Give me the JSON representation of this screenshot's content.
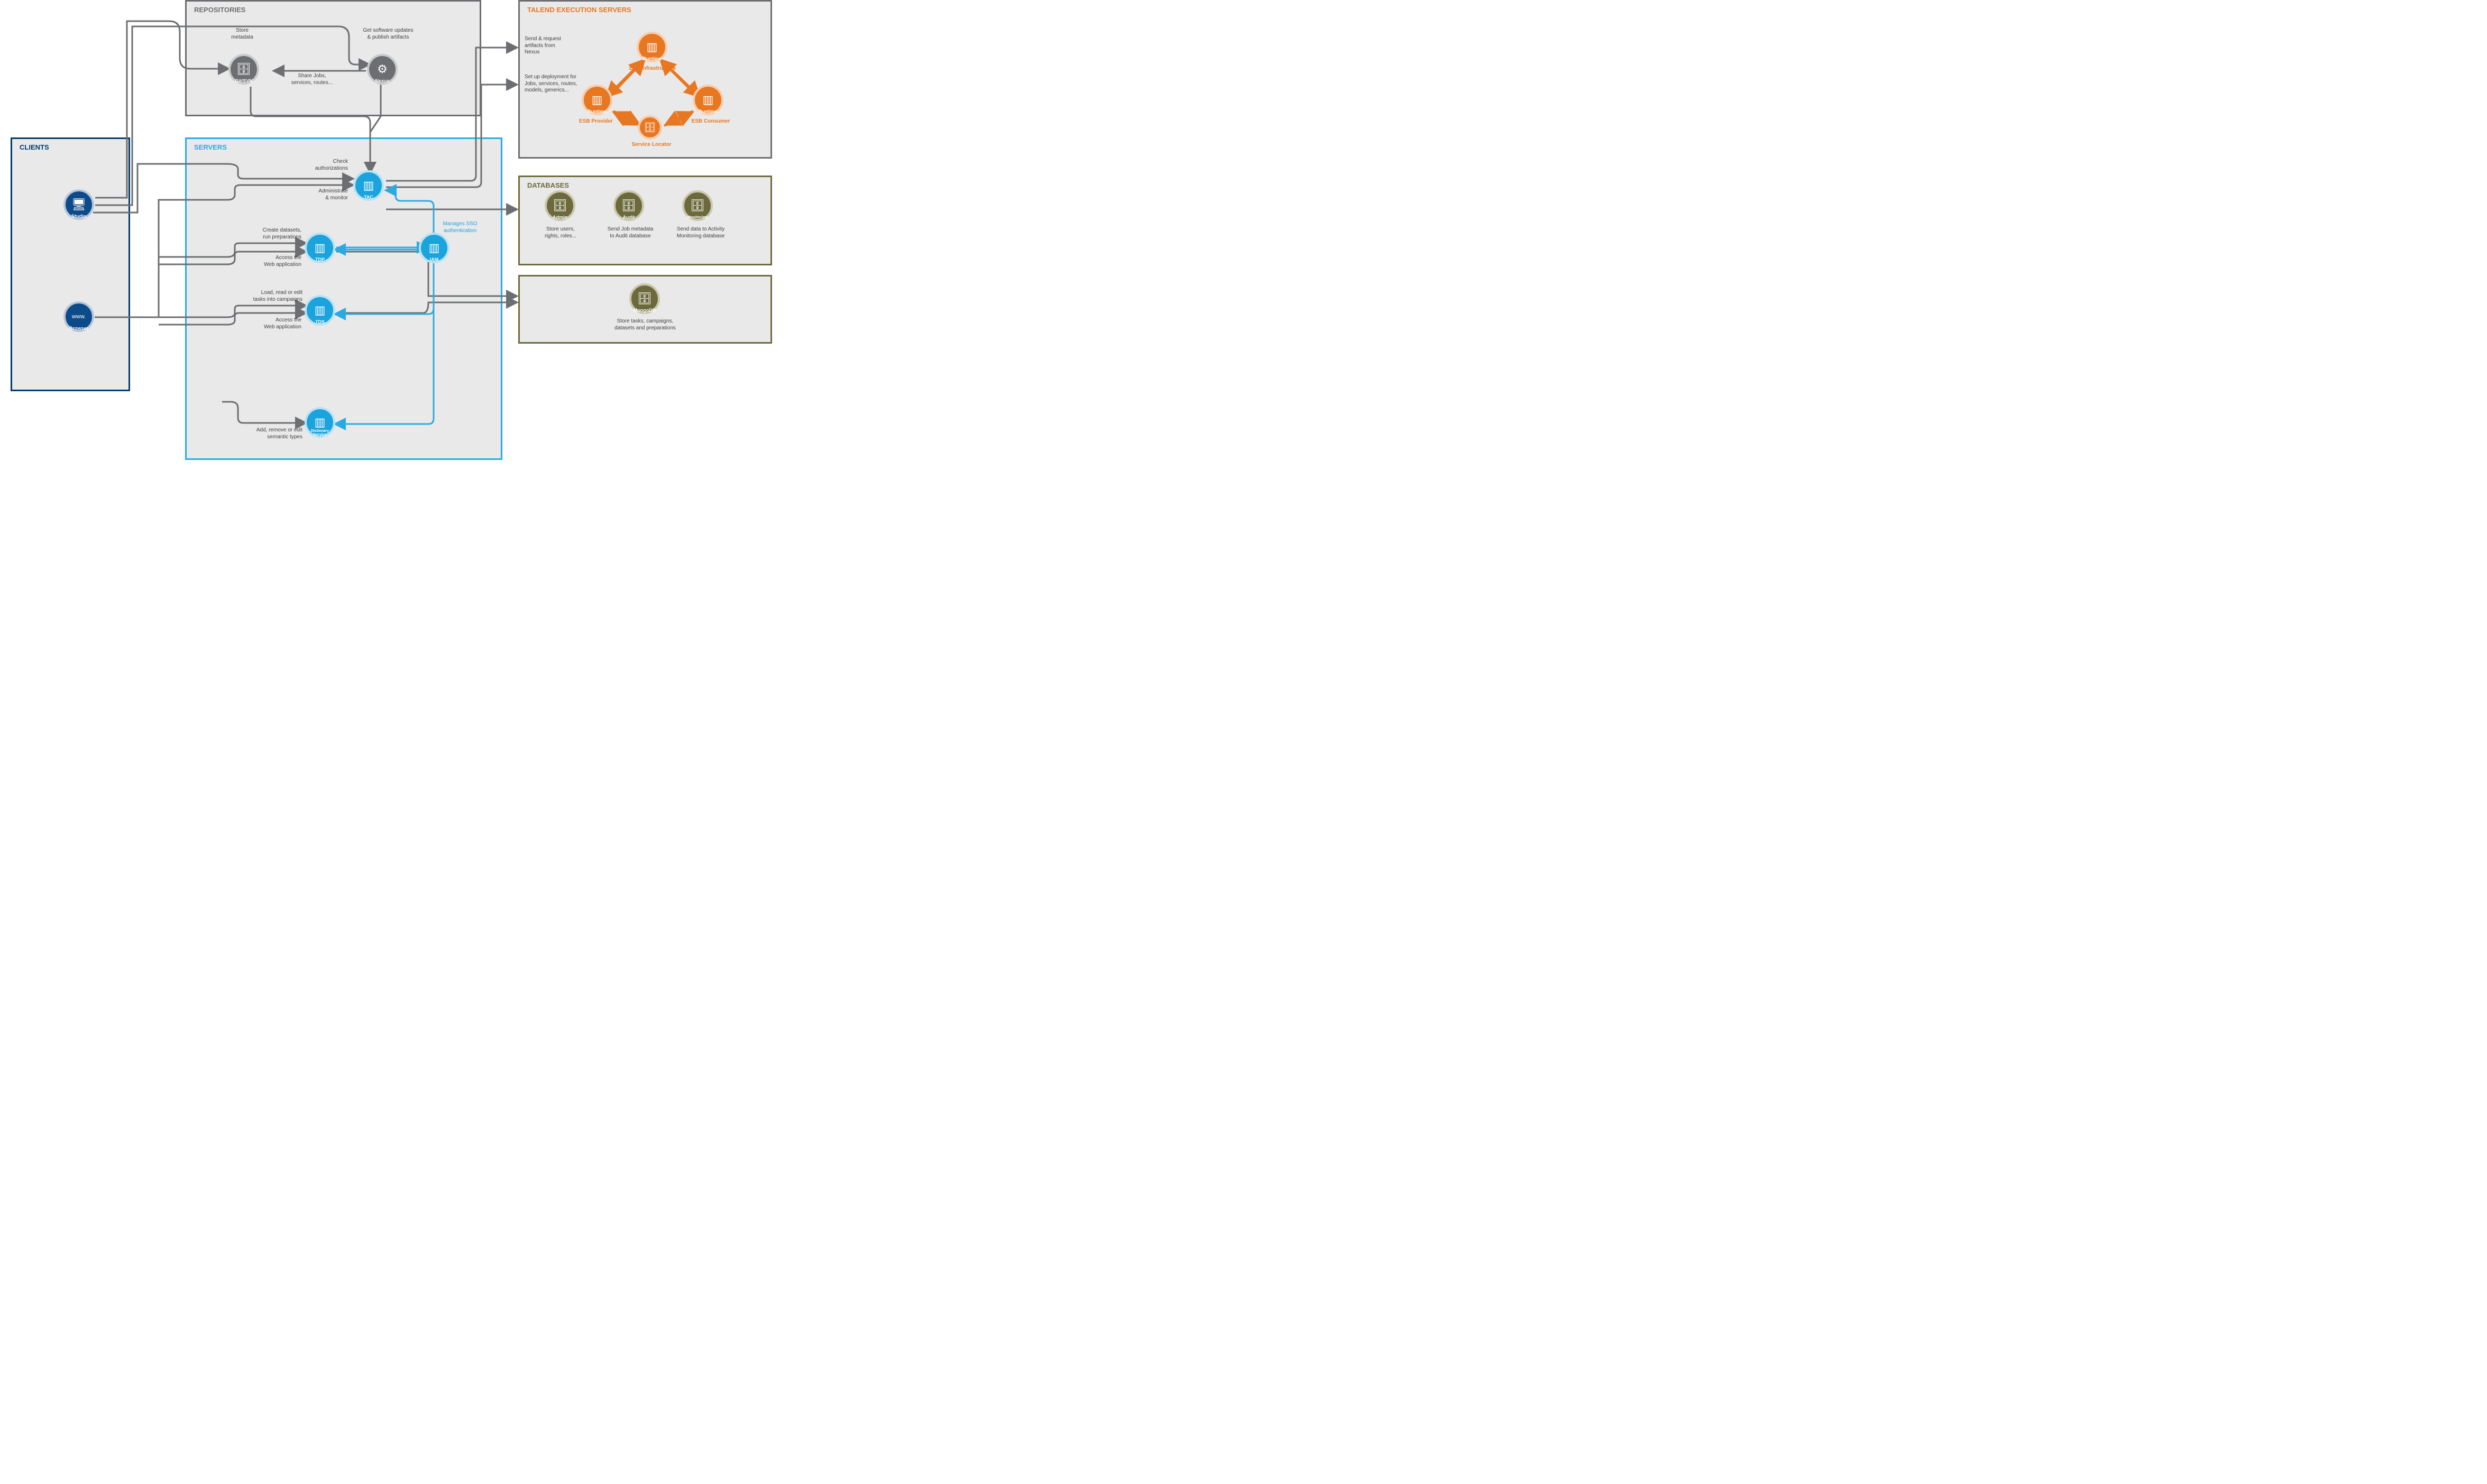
{
  "zones": {
    "clients": {
      "title": "CLIENTS"
    },
    "repos": {
      "title": "REPOSITORIES"
    },
    "servers": {
      "title": "SERVERS"
    },
    "exec": {
      "title": "TALEND EXECUTION SERVERS"
    },
    "databases": {
      "title": "DATABASES"
    }
  },
  "nodes": {
    "studio": {
      "label": "Studio"
    },
    "browser": {
      "label": "Browser"
    },
    "gitsvn": {
      "label": "Git/SVN"
    },
    "nexus": {
      "label": "Nexus"
    },
    "tac": {
      "label": "TAC"
    },
    "tdp": {
      "label": "TDP"
    },
    "tds": {
      "label": "TDS"
    },
    "dict": {
      "label": "Dictionary Service"
    },
    "iam": {
      "label": "IAM"
    },
    "runtime1": {
      "label": "Runtime"
    },
    "runtime2": {
      "label": "Runtime"
    },
    "runtime3": {
      "label": "Runtime"
    },
    "svcloc": {
      "label": "Service Locator"
    },
    "admin": {
      "label": "Admin"
    },
    "audit": {
      "label": "Audit"
    },
    "monitor": {
      "label": "Monitoring"
    },
    "mongo": {
      "label": "MongoDB"
    }
  },
  "ann": {
    "store_metadata": "Store\nmetadata",
    "get_updates": "Get software updates\n& publish artifacts",
    "share_jobs": "Share Jobs,\nservices, routes...",
    "check_auth": "Check\nauthorizations",
    "admin_monitor": "Administrate\n& monitor",
    "create_ds": "Create datasets,\nrun preparations",
    "access_web1": "Access the\nWeb application",
    "load_edit": "Load, read or edit\ntasks into campaigns",
    "access_web2": "Access the\nWeb application",
    "add_semantic": "Add, remove or edit\nsemantic types",
    "manages_sso": "Manages SSO\nauthentication",
    "send_artifacts": "Send & request\nartifacts from\nNexus",
    "setup_deploy": "Set up deployment for\nJobs, services, routes,\nmodels, generics...",
    "store_users": "Store users,\nrights, roles...",
    "send_audit": "Send Job metadata\nto Audit database",
    "send_activity": "Send data to Activity\nMonitoring database",
    "store_tasks": "Store tasks, campaigns,\ndatasets and preparations",
    "esb_infra": "ESB Infrastructure",
    "esb_provider": "ESB Provider",
    "esb_consumer": "ESB Consumer"
  }
}
